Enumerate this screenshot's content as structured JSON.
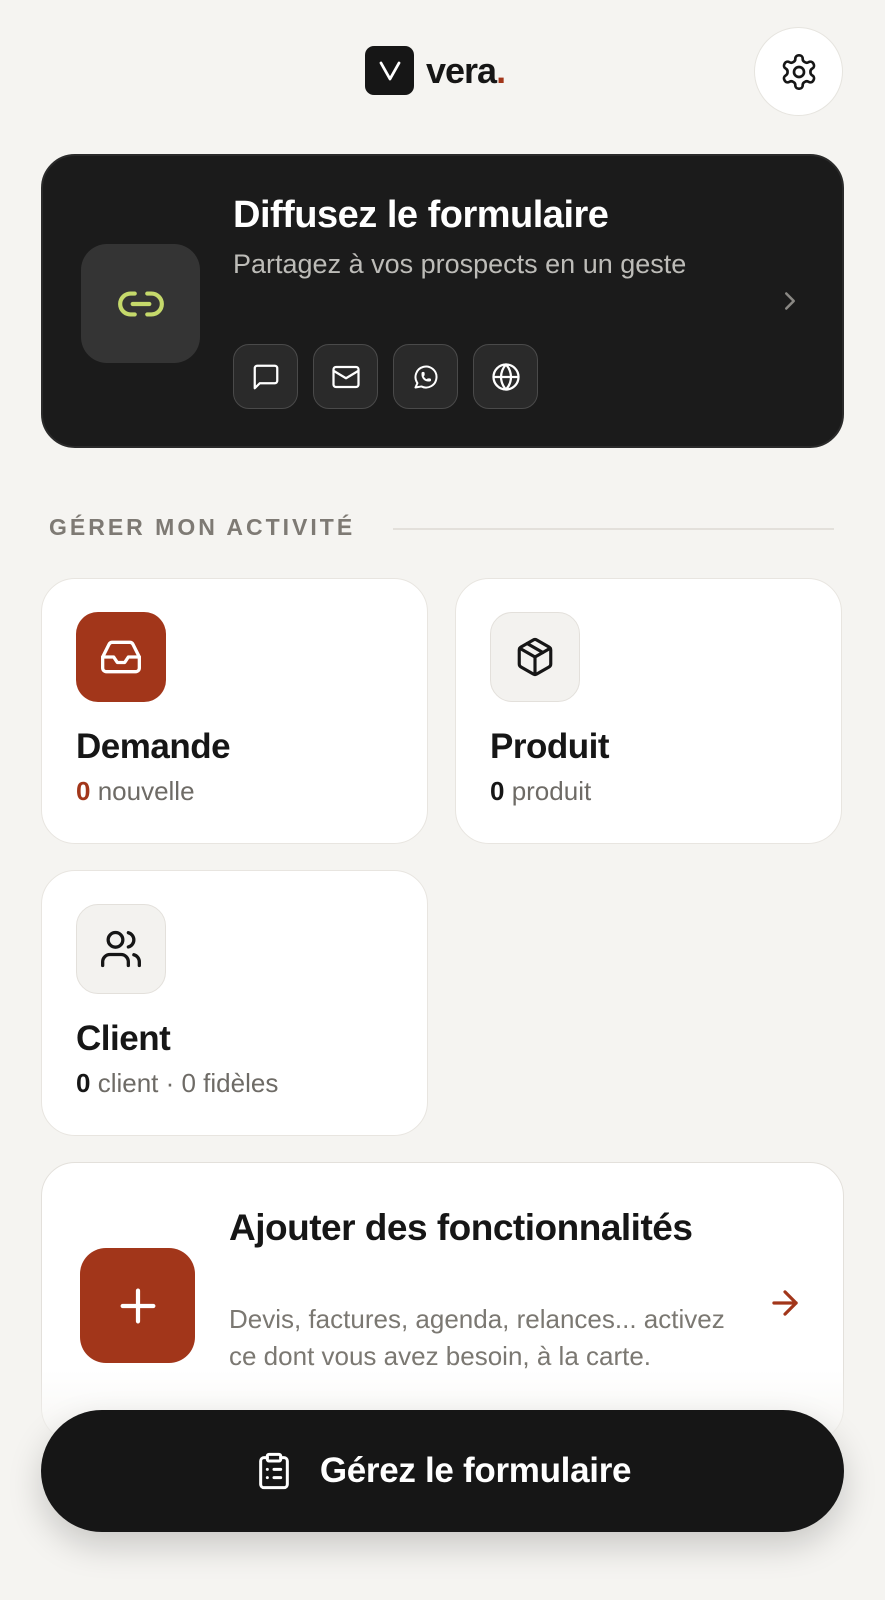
{
  "header": {
    "brand_name": "vera",
    "brand_dot": ".",
    "settings_icon": "gear-icon"
  },
  "share_card": {
    "title": "Diffusez le formulaire",
    "subtitle": "Partagez à vos prospects en un geste",
    "icon": "link-icon",
    "accent_color": "#c5d96b",
    "actions": [
      "message-icon",
      "mail-icon",
      "whatsapp-icon",
      "globe-icon"
    ]
  },
  "section": {
    "label": "GÉRER MON ACTIVITÉ"
  },
  "tiles": [
    {
      "title": "Demande",
      "count": "0",
      "suffix": " nouvelle",
      "icon": "inbox-icon"
    },
    {
      "title": "Produit",
      "count": "0",
      "suffix": " produit",
      "icon": "package-icon"
    },
    {
      "title": "Client",
      "count": "0",
      "suffix": " client · 0 fidèles",
      "icon": "users-icon"
    }
  ],
  "add_card": {
    "title": "Ajouter des fonctionnalités",
    "description": "Devis, factures, agenda, relances... activez ce dont vous avez besoin, à la carte.",
    "icon": "plus-icon"
  },
  "cta": {
    "label": "Gérez le formulaire",
    "icon": "clipboard-icon"
  },
  "colors": {
    "background": "#f5f4f1",
    "accent": "#a2361a",
    "dark": "#161616"
  }
}
